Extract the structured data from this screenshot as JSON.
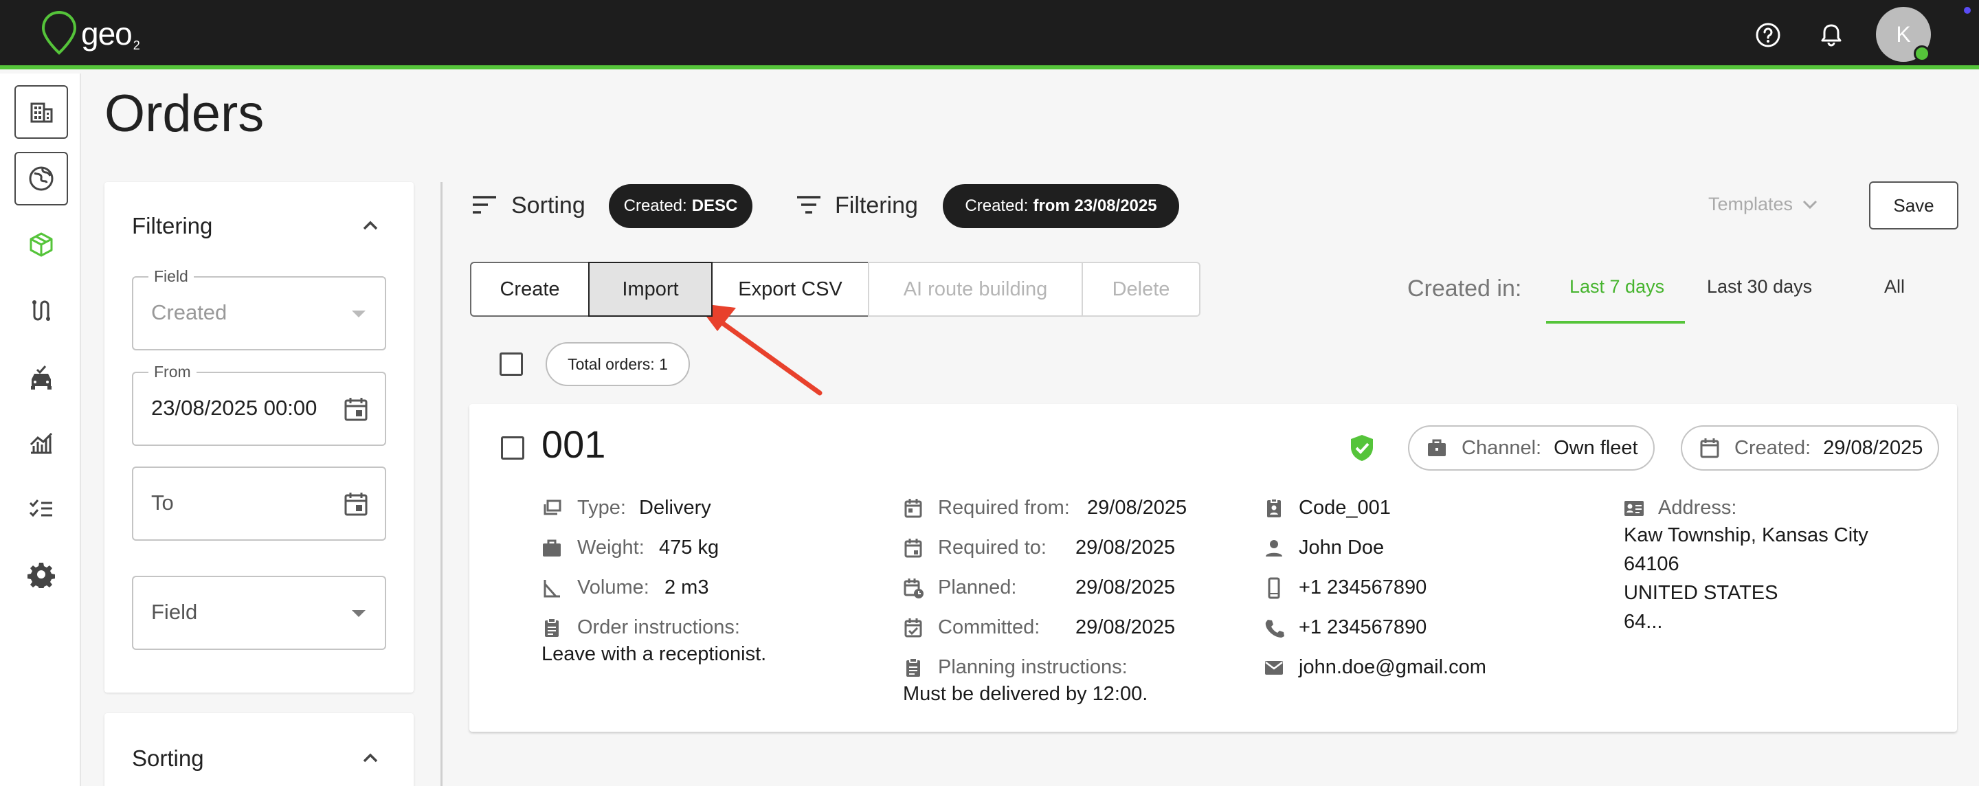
{
  "app": {
    "logo_text": "geo",
    "logo_sub": "2",
    "avatar_initial": "K",
    "accent": "#55c43a",
    "topbar_bg": "#1d1d1d",
    "annotation_arrow_color": "#e8412c"
  },
  "sidebar": {
    "items": [
      {
        "icon": "building-icon",
        "boxed": true
      },
      {
        "icon": "globe-icon",
        "boxed": true
      },
      {
        "icon": "package-icon",
        "active": true
      },
      {
        "icon": "route-icon"
      },
      {
        "icon": "vehicle-icon"
      },
      {
        "icon": "analytics-icon"
      },
      {
        "icon": "checklist-icon"
      },
      {
        "icon": "gear-icon"
      }
    ]
  },
  "page": {
    "title": "Orders"
  },
  "filter_panel": {
    "title": "Filtering",
    "field1": {
      "label": "Field",
      "value": "Created"
    },
    "from": {
      "label": "From",
      "value": "23/08/2025 00:00"
    },
    "to": {
      "placeholder": "To"
    },
    "field2": {
      "placeholder": "Field"
    },
    "sorting_title": "Sorting"
  },
  "toolbar": {
    "sorting_label": "Sorting",
    "sorting_chip": {
      "key": "Created:",
      "value": "DESC"
    },
    "filtering_label": "Filtering",
    "filtering_chip": {
      "key": "Created:",
      "value": "from 23/08/2025"
    },
    "templates_label": "Templates",
    "save_label": "Save"
  },
  "actions": {
    "create": "Create",
    "import": "Import",
    "export_csv": "Export CSV",
    "ai_route": "AI route building",
    "delete": "Delete"
  },
  "created_in": {
    "label": "Created in:",
    "tabs": [
      "Last 7 days",
      "Last 30 days",
      "All"
    ],
    "active": "Last 7 days"
  },
  "list": {
    "total_orders": "Total orders: 1"
  },
  "order": {
    "id": "001",
    "verified": true,
    "channel": {
      "label": "Channel:",
      "value": "Own fleet"
    },
    "created": {
      "label": "Created:",
      "value": "29/08/2025"
    },
    "type": {
      "label": "Type:",
      "value": "Delivery"
    },
    "weight": {
      "label": "Weight:",
      "value": "475 kg"
    },
    "volume": {
      "label": "Volume:",
      "value": "2 m3"
    },
    "order_instructions": {
      "label": "Order instructions:",
      "value": "Leave with a receptionist."
    },
    "required_from": {
      "label": "Required from:",
      "value": "29/08/2025"
    },
    "required_to": {
      "label": "Required to:",
      "value": "29/08/2025"
    },
    "planned": {
      "label": "Planned:",
      "value": "29/08/2025"
    },
    "committed": {
      "label": "Committed:",
      "value": "29/08/2025"
    },
    "planning_instructions": {
      "label": "Planning instructions:",
      "value": "Must be delivered by 12:00."
    },
    "code": "Code_001",
    "contact_name": "John Doe",
    "mobile": "+1 234567890",
    "phone": "+1 234567890",
    "email": "john.doe@gmail.com",
    "address": {
      "label": "Address:",
      "lines": [
        "Kaw Township, Kansas City",
        "64106",
        "UNITED STATES",
        "64..."
      ]
    }
  }
}
